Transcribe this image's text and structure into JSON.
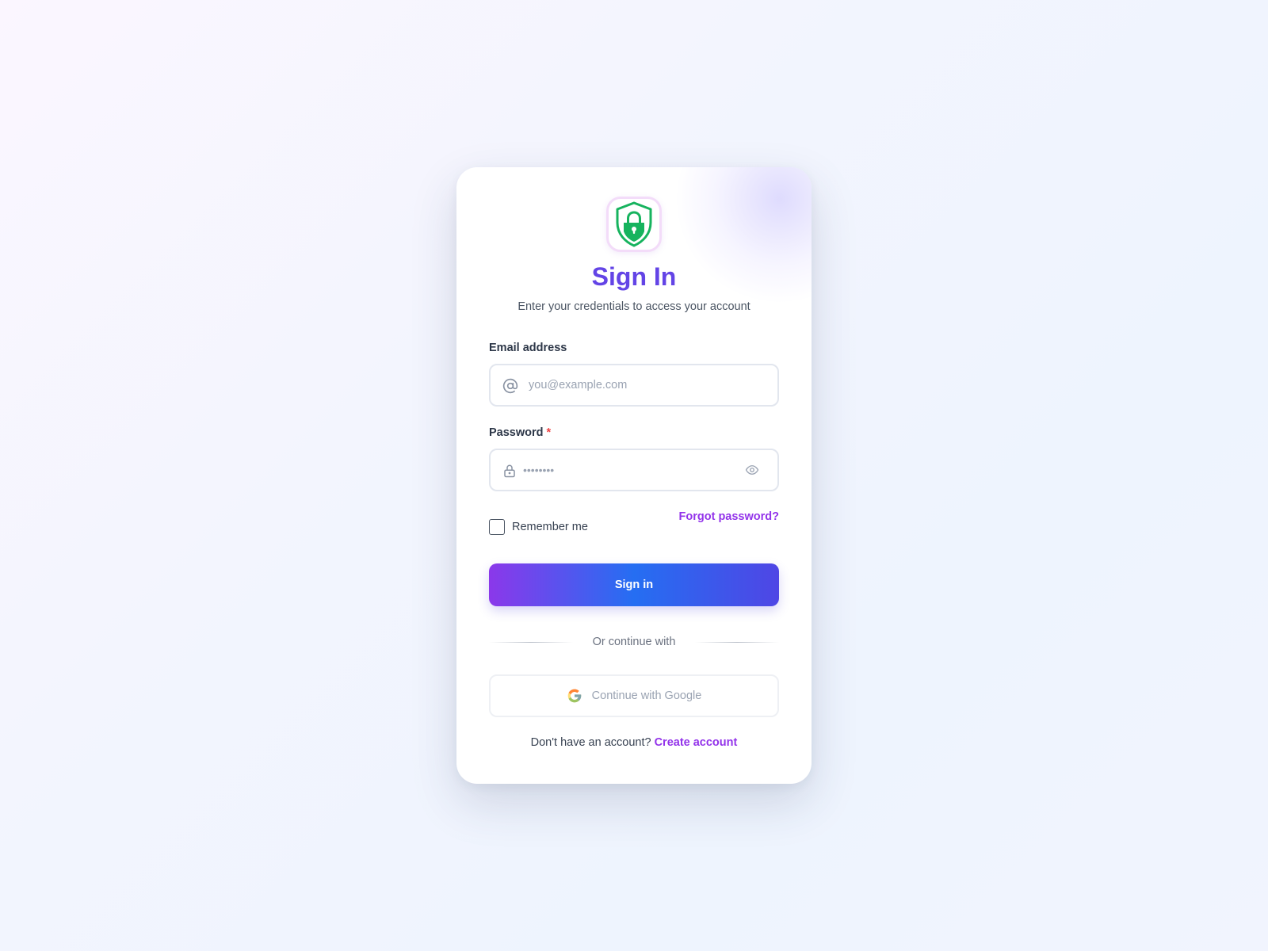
{
  "header": {
    "title": "Sign In",
    "subtitle": "Enter your credentials to access your account"
  },
  "email": {
    "label": "Email address",
    "placeholder": "you@example.com",
    "value": ""
  },
  "password": {
    "label": "Password",
    "required_marker": "*",
    "masked_value": "••••••••"
  },
  "remember": {
    "label": "Remember me",
    "checked": false
  },
  "forgot_label": "Forgot password?",
  "signin_label": "Sign in",
  "divider_label": "Or continue with",
  "google_label": "Continue with Google",
  "footer": {
    "prompt": "Don't have an account?",
    "link_label": "Create account"
  },
  "colors": {
    "title": "#6344e6",
    "accent_link": "#9333ea",
    "button_gradient": [
      "#8b38ea",
      "#256ef2",
      "#4f46e5"
    ],
    "shield": "#16b35e",
    "required": "#ef4444"
  },
  "icons": {
    "logo": "shield-lock-icon",
    "email": "at-sign-icon",
    "password": "lock-icon",
    "reveal": "eye-icon",
    "google": "google-g-icon"
  }
}
